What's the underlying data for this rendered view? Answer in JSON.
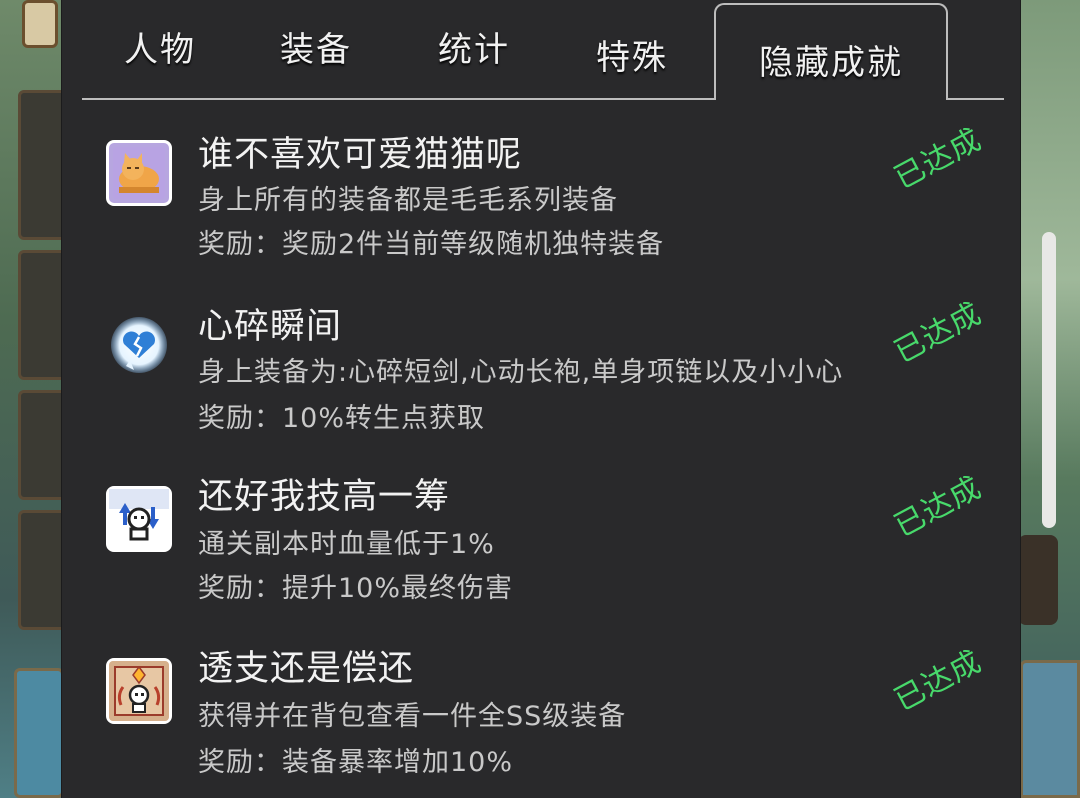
{
  "tabs": [
    {
      "label": "人物",
      "active": false
    },
    {
      "label": "装备",
      "active": false
    },
    {
      "label": "统计",
      "active": false
    },
    {
      "label": "特殊",
      "active": false
    },
    {
      "label": "隐藏成就",
      "active": true
    }
  ],
  "achievements": [
    {
      "icon": "cat-icon",
      "title": "谁不喜欢可爱猫猫呢",
      "desc": "身上所有的装备都是毛毛系列装备",
      "reward": "奖励：奖励2件当前等级随机独特装备",
      "status": "已达成"
    },
    {
      "icon": "broken-heart-icon",
      "title": "心碎瞬间",
      "desc": "身上装备为:心碎短剑,心动长袍,单身项链以及小小心",
      "reward": "奖励：10%转生点获取",
      "status": "已达成"
    },
    {
      "icon": "skull-arrows-icon",
      "title": "还好我技高一筹",
      "desc": "通关副本时血量低于1%",
      "reward": "奖励：提升10%最终伤害",
      "status": "已达成"
    },
    {
      "icon": "skull-badge-icon",
      "title": "透支还是偿还",
      "desc": "获得并在背包查看一件全SS级装备",
      "reward": "奖励：装备暴率增加10%",
      "status": "已达成"
    }
  ],
  "colors": {
    "panel": "#29292b",
    "status": "#48d96b",
    "text": "#f2f2f2",
    "subtext": "#c9c9c9"
  }
}
